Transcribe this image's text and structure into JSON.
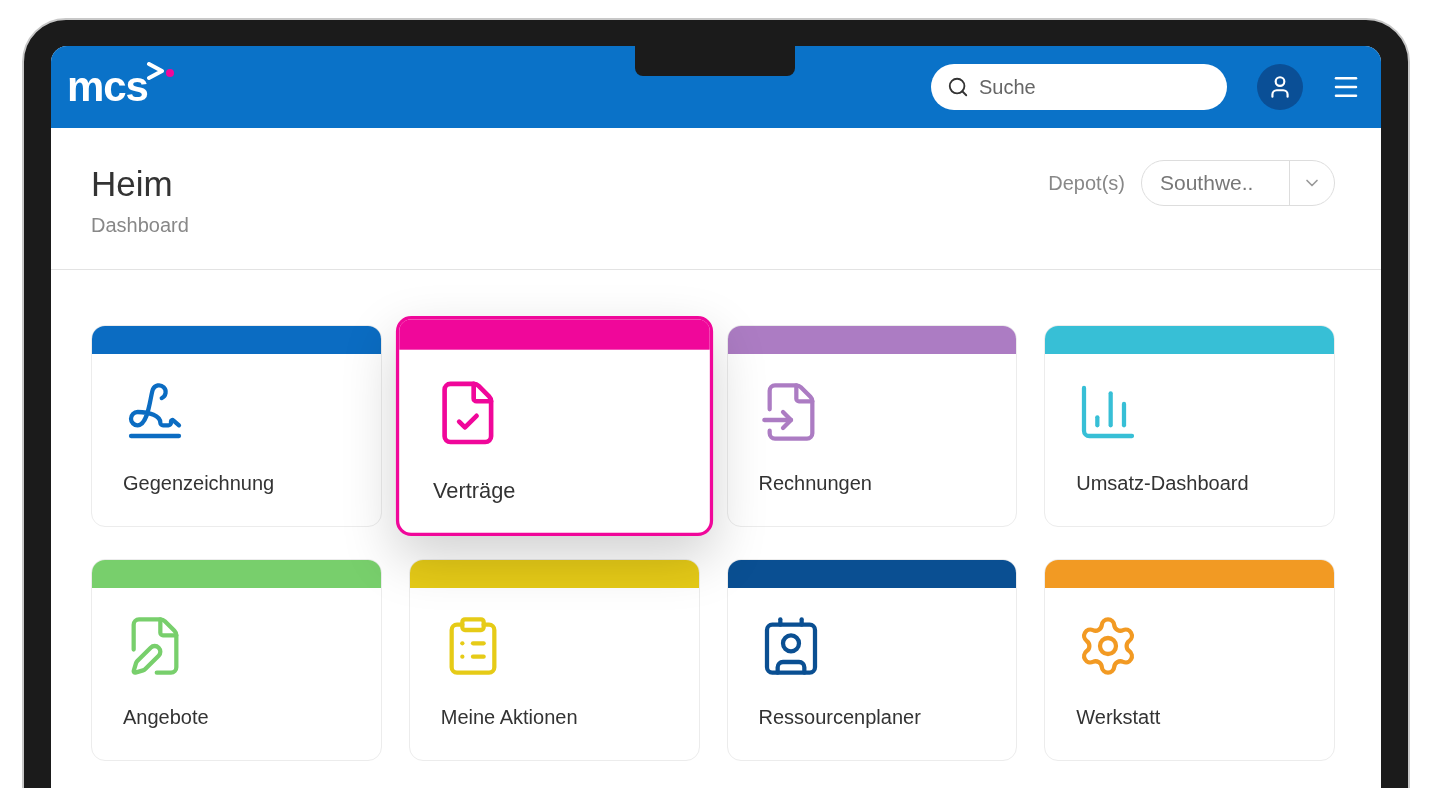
{
  "header": {
    "logo": "mcs",
    "search": {
      "placeholder": "Suche"
    }
  },
  "page": {
    "title": "Heim",
    "subtitle": "Dashboard"
  },
  "depot": {
    "label": "Depot(s)",
    "value": "Southwe.."
  },
  "tiles": [
    {
      "label": "Gegenzeichnung",
      "color": "#0b6cc2",
      "selected": false
    },
    {
      "label": "Verträge",
      "color": "#f0079a",
      "selected": true
    },
    {
      "label": "Rechnungen",
      "color": "#ac7cc3",
      "selected": false
    },
    {
      "label": "Umsatz-Dashboard",
      "color": "#37bfd6",
      "selected": false
    },
    {
      "label": "Angebote",
      "color": "#78cf6c",
      "selected": false
    },
    {
      "label": "Meine Aktionen",
      "color": "#e6cb17",
      "selected": false
    },
    {
      "label": "Ressourcenplaner",
      "color": "#0a4f92",
      "selected": false
    },
    {
      "label": "Werkstatt",
      "color": "#f29a23",
      "selected": false
    }
  ]
}
